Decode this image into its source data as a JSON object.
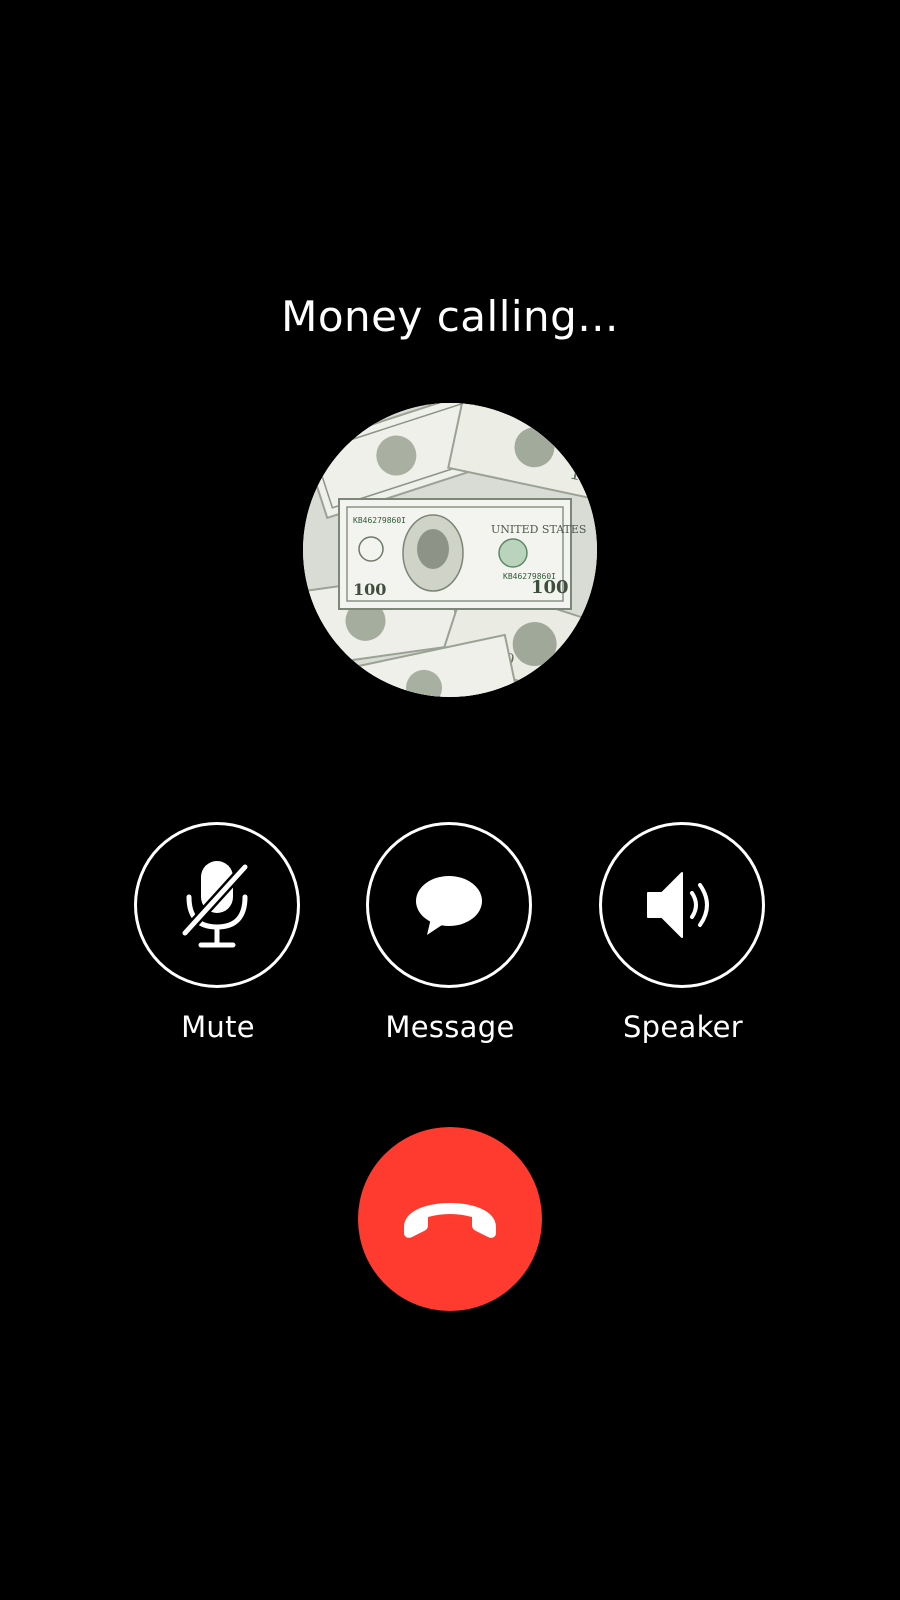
{
  "call": {
    "title": "Money calling..."
  },
  "avatar": {
    "description_icon": "dollar-bills-photo"
  },
  "actions": [
    {
      "label": "Mute",
      "icon": "mic-off-icon"
    },
    {
      "label": "Message",
      "icon": "chat-bubble-icon"
    },
    {
      "label": "Speaker",
      "icon": "speaker-icon"
    }
  ],
  "end_call": {
    "icon": "phone-hangup-icon",
    "color": "#ff3b30"
  },
  "colors": {
    "background": "#000000",
    "foreground": "#ffffff",
    "end_call": "#ff3b30"
  }
}
